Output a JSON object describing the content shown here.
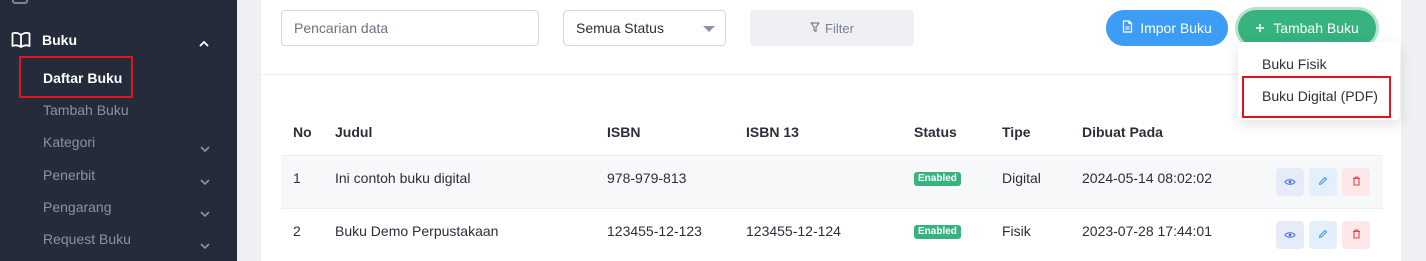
{
  "sidebar": {
    "section_label": "Buku",
    "items": [
      {
        "label": "Daftar Buku"
      },
      {
        "label": "Tambah Buku"
      },
      {
        "label": "Kategori"
      },
      {
        "label": "Penerbit"
      },
      {
        "label": "Pengarang"
      },
      {
        "label": "Request Buku"
      }
    ]
  },
  "toolbar": {
    "search_placeholder": "Pencarian data",
    "status_selected": "Semua Status",
    "filter_label": "Filter",
    "import_label": "Impor Buku",
    "add_label": "Tambah Buku"
  },
  "dropdown": {
    "items": [
      {
        "label": "Buku Fisik"
      },
      {
        "label": "Buku Digital (PDF)"
      }
    ]
  },
  "table": {
    "headers": [
      "No",
      "Judul",
      "ISBN",
      "ISBN 13",
      "Status",
      "Tipe",
      "Dibuat Pada"
    ],
    "rows": [
      {
        "no": "1",
        "judul": "Ini contoh buku digital",
        "isbn": "978-979-813",
        "isbn13": "",
        "status": "Enabled",
        "tipe": "Digital",
        "dibuat": "2024-05-14 08:02:02"
      },
      {
        "no": "2",
        "judul": "Buku Demo Perpustakaan",
        "isbn": "123455-12-123",
        "isbn13": "123455-12-124",
        "status": "Enabled",
        "tipe": "Fisik",
        "dibuat": "2023-07-28 17:44:01"
      }
    ]
  },
  "colors": {
    "sidebar_bg": "#262b3c",
    "primary_blue": "#3d9cf5",
    "success_green": "#36b37e",
    "highlight_red": "#e3141b"
  }
}
